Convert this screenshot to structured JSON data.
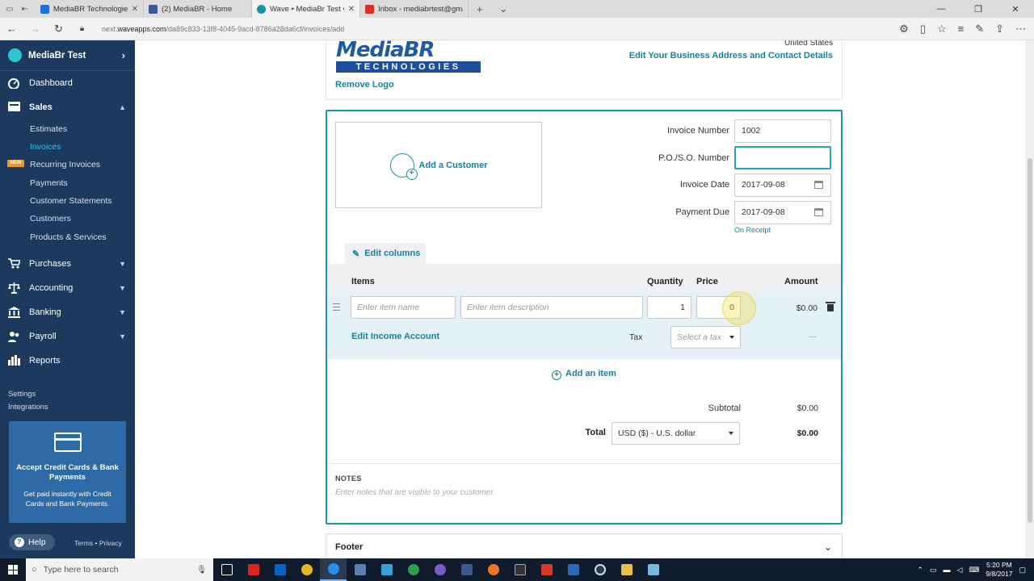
{
  "browser": {
    "tabs": [
      {
        "title": "MediaBR Technologies – Pro",
        "color": "#1e6fd9"
      },
      {
        "title": "(2) MediaBR - Home",
        "color": "#3b5998"
      },
      {
        "title": "Wave • MediaBr Test • In",
        "color": "#1a93a6"
      },
      {
        "title": "Inbox - mediabrtest@gmail",
        "color": "#d93025"
      }
    ],
    "url_prefix": "next.",
    "url_domain": "waveapps.com",
    "url_path": "/da89c833-13f8-4045-9acd-8786a28da6cf/invoices/add"
  },
  "sidebar": {
    "business_name": "MediaBr Test",
    "main_items": {
      "dashboard": "Dashboard",
      "sales": "Sales",
      "purchases": "Purchases",
      "accounting": "Accounting",
      "banking": "Banking",
      "payroll": "Payroll",
      "reports": "Reports"
    },
    "sales_items": {
      "estimates": "Estimates",
      "invoices": "Invoices",
      "recurring": "Recurring Invoices",
      "new_badge": "NEW",
      "payments": "Payments",
      "statements": "Customer Statements",
      "customers": "Customers",
      "products": "Products & Services"
    },
    "settings": "Settings",
    "integrations": "Integrations",
    "promo": {
      "title": "Accept Credit Cards & Bank Payments",
      "body": "Get paid instantly with Credit Cards and Bank Payments."
    },
    "help": "Help",
    "terms": "Terms",
    "separator": "•",
    "privacy": "Privacy"
  },
  "header": {
    "logo_top": "MediaBR",
    "logo_bottom": "TECHNOLOGIES",
    "remove_logo": "Remove Logo",
    "country": "United States",
    "edit_address": "Edit Your Business Address and Contact Details"
  },
  "invoice": {
    "add_customer": "Add a Customer",
    "invoice_number_label": "Invoice Number",
    "invoice_number": "1002",
    "po_label": "P.O./S.O. Number",
    "po_value": "",
    "invoice_date_label": "Invoice Date",
    "invoice_date": "2017-09-08",
    "payment_due_label": "Payment Due",
    "payment_due": "2017-09-08",
    "on_receipt": "On Receipt",
    "edit_columns": "Edit columns",
    "columns": {
      "items": "Items",
      "quantity": "Quantity",
      "price": "Price",
      "amount": "Amount"
    },
    "row": {
      "item_name_placeholder": "Enter item name",
      "item_desc_placeholder": "Enter item description",
      "quantity": "1",
      "price": "0",
      "amount": "$0.00",
      "edit_income": "Edit Income Account",
      "tax_label": "Tax",
      "tax_placeholder": "Select a tax",
      "tax_amount": "—"
    },
    "add_item": "Add an item",
    "subtotal_label": "Subtotal",
    "subtotal": "$0.00",
    "total_label": "Total",
    "currency": "USD ($) - U.S. dollar",
    "total": "$0.00",
    "notes_label": "NOTES",
    "notes_placeholder": "Enter notes that are visible to your customer",
    "footer_label": "Footer"
  },
  "taskbar": {
    "search_placeholder": "Type here to search",
    "time": "5:20 PM",
    "date": "9/8/2017"
  }
}
